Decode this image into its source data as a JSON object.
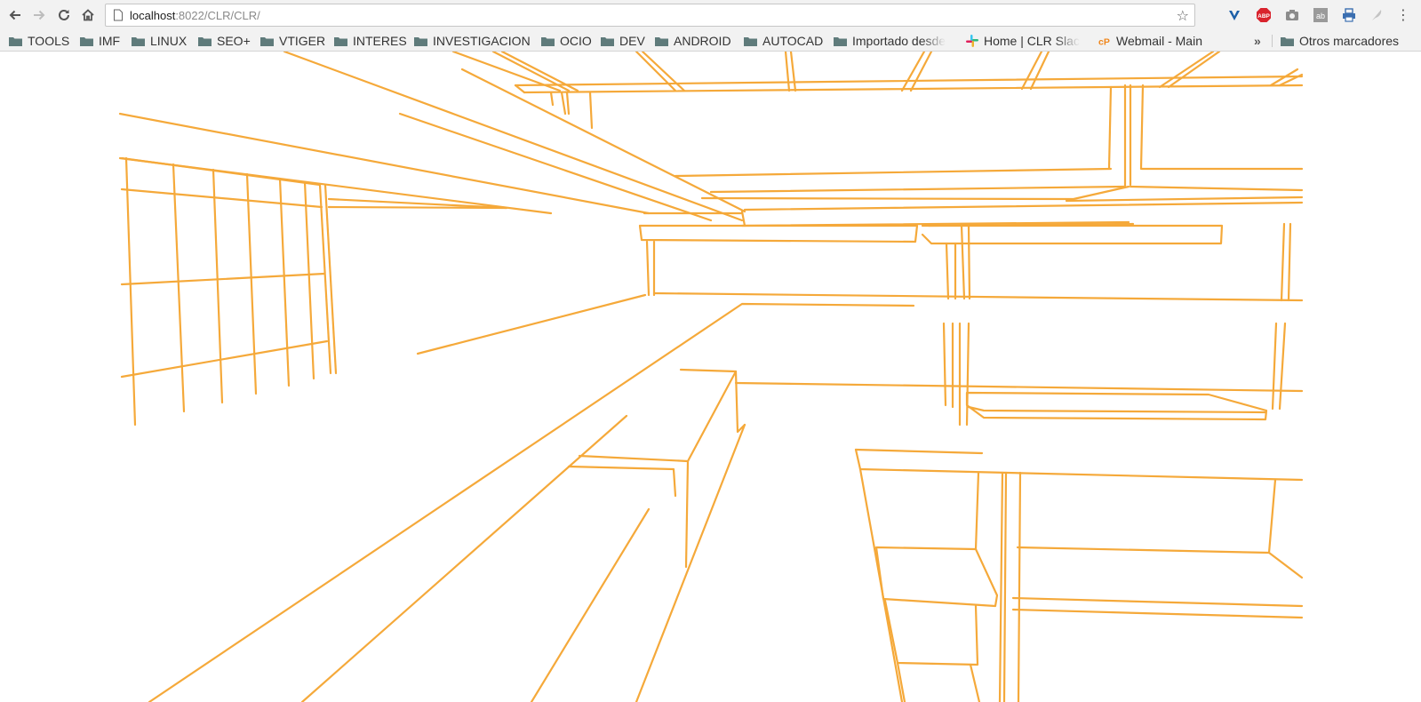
{
  "browser": {
    "url_host": "localhost",
    "url_rest": ":8022/CLR/CLR/",
    "icons": {
      "back": "back-arrow-icon",
      "forward": "forward-arrow-icon",
      "reload": "reload-icon",
      "home": "home-icon",
      "star": "bookmark-star-icon",
      "menu": "kebab-menu-icon"
    },
    "extensions": [
      "vivaldi-v-icon",
      "adblock-plus-icon",
      "camera-icon",
      "ab-icon",
      "printer-icon",
      "feather-icon"
    ],
    "extension_labels": {
      "adblock": "ABP",
      "ab": "ab"
    }
  },
  "bookmarks": [
    {
      "label": "TOOLS",
      "icon": "folder-icon"
    },
    {
      "label": "IMF",
      "icon": "folder-icon"
    },
    {
      "label": "LINUX",
      "icon": "folder-icon"
    },
    {
      "label": "SEO+",
      "icon": "folder-icon"
    },
    {
      "label": "VTIGER",
      "icon": "folder-icon"
    },
    {
      "label": "INTERES",
      "icon": "folder-icon"
    },
    {
      "label": "INVESTIGACION",
      "icon": "folder-icon"
    },
    {
      "label": "OCIO",
      "icon": "folder-icon"
    },
    {
      "label": "DEV",
      "icon": "folder-icon"
    },
    {
      "label": "ANDROID",
      "icon": "folder-icon"
    },
    {
      "label": "AUTOCAD",
      "icon": "folder-icon"
    },
    {
      "label": "Importado desde",
      "icon": "folder-icon"
    },
    {
      "label": "Home | CLR Slac",
      "icon": "slack-icon"
    },
    {
      "label": "Webmail - Main",
      "icon": "cpanel-icon"
    }
  ],
  "bookmarks_overflow": "»",
  "other_bookmarks": "Otros marcadores",
  "drawing": {
    "stroke_color": "#f5a93a",
    "background": "#ffffff"
  },
  "colors": {
    "toolbar_bg": "#f2f2f2",
    "folder_icon": "#5f7b7b",
    "abp_red": "#d9232d",
    "vivaldi_blue": "#1b5fa8",
    "printer_blue": "#3b6fb0",
    "cpanel_orange": "#f0861b"
  }
}
